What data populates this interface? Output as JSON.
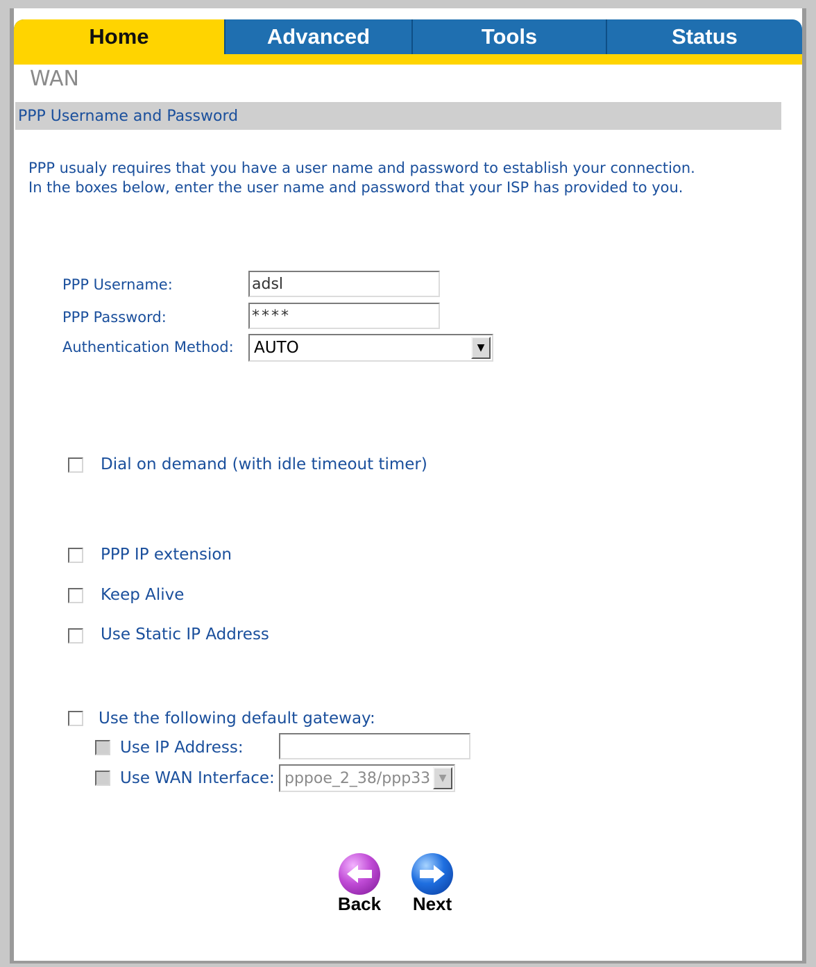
{
  "tabs": [
    {
      "label": "Home",
      "active": true
    },
    {
      "label": "Advanced",
      "active": false
    },
    {
      "label": "Tools",
      "active": false
    },
    {
      "label": "Status",
      "active": false
    }
  ],
  "page_title": "WAN",
  "section_title": "PPP Username and Password",
  "intro": {
    "line1": "PPP usualy requires that you have a user name and password to establish your connection.",
    "line2": "In the boxes below, enter the user name and password that your ISP has provided to you."
  },
  "form": {
    "username": {
      "label": "PPP Username:",
      "value": "adsl"
    },
    "password": {
      "label": "PPP Password:",
      "value": "****"
    },
    "auth_method": {
      "label": "Authentication Method:",
      "value": "AUTO"
    }
  },
  "options": {
    "dial_on_demand": {
      "label": "Dial on demand (with idle timeout timer)",
      "checked": false
    },
    "ppp_ip_extension": {
      "label": "PPP IP extension",
      "checked": false
    },
    "keep_alive": {
      "label": "Keep Alive",
      "checked": false
    },
    "use_static_ip": {
      "label": "Use Static IP Address",
      "checked": false
    },
    "default_gateway": {
      "label": "Use the following default gateway:",
      "checked": false
    },
    "use_ip_address": {
      "label": "Use IP Address:",
      "checked": false,
      "disabled": true,
      "value": ""
    },
    "use_wan_interface": {
      "label": "Use WAN Interface:",
      "checked": false,
      "disabled": true,
      "value": "pppoe_2_38/ppp33"
    }
  },
  "nav": {
    "back_label": "Back",
    "next_label": "Next"
  },
  "colors": {
    "tab_active": "#ffd400",
    "tab_bar": "#1f6fb0",
    "text_blue": "#1a4f9c"
  }
}
